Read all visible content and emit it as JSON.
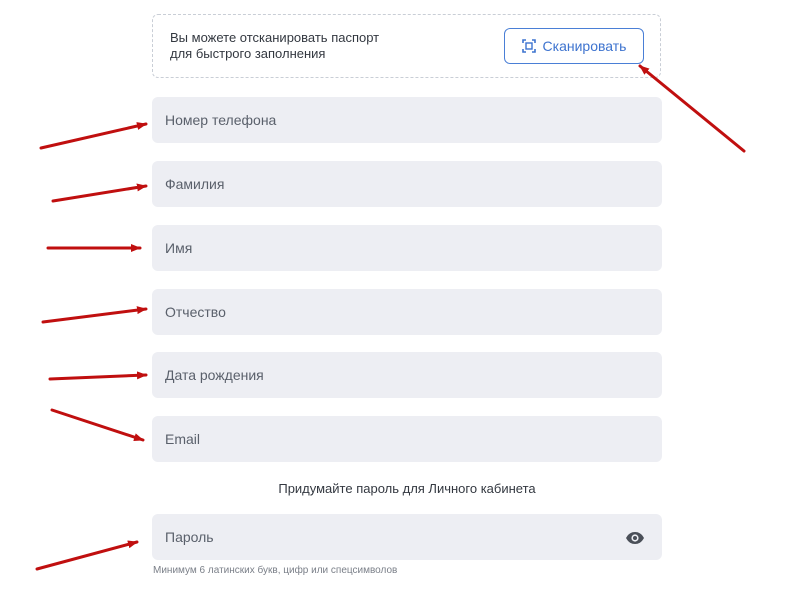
{
  "scan": {
    "text": "Вы можете отсканировать паспорт\nдля быстрого заполнения",
    "button_label": "Сканировать",
    "button_icon": "scan-frame-icon"
  },
  "fields": {
    "phone": {
      "placeholder": "Номер телефона"
    },
    "last_name": {
      "placeholder": "Фамилия"
    },
    "first_name": {
      "placeholder": "Имя"
    },
    "patronymic": {
      "placeholder": "Отчество"
    },
    "birth_date": {
      "placeholder": "Дата рождения"
    },
    "email": {
      "placeholder": "Email"
    },
    "password": {
      "placeholder": "Пароль",
      "toggle_icon": "eye-icon"
    }
  },
  "password_section": {
    "title": "Придумайте пароль для Личного кабинета",
    "hint": "Минимум 6 латинских букв, цифр или спецсимволов"
  },
  "colors": {
    "accent": "#3d73cf",
    "field_bg": "#edeef3",
    "annotation_arrow": "#c00f0f"
  }
}
